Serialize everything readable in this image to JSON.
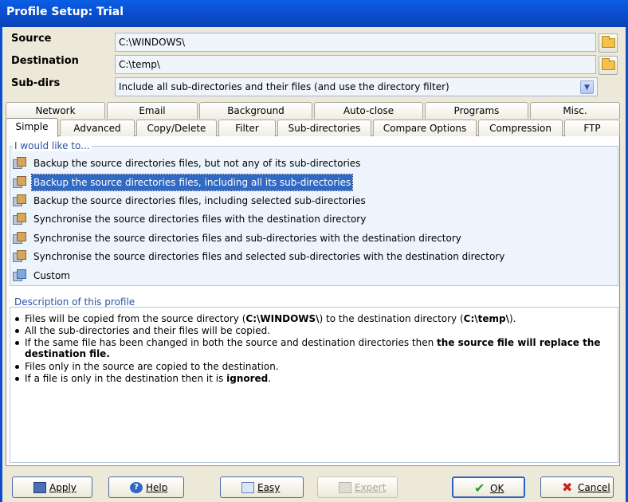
{
  "window": {
    "title": "Profile Setup: Trial"
  },
  "form": {
    "source_label": "Source",
    "source_value": "C:\\WINDOWS\\",
    "destination_label": "Destination",
    "destination_value": "C:\\temp\\",
    "subdirs_label": "Sub-dirs",
    "subdirs_value": "Include all sub-directories and their files (and use the directory filter)"
  },
  "tabs_row1": [
    "Network",
    "Email",
    "Background",
    "Auto-close",
    "Programs",
    "Misc."
  ],
  "tabs_row2": [
    "Simple",
    "Advanced",
    "Copy/Delete",
    "Filter",
    "Sub-directories",
    "Compare Options",
    "Compression",
    "FTP"
  ],
  "options_group": {
    "title": "I would like to...",
    "items": [
      "Backup the source directories files, but not any of its sub-directories",
      "Backup the source directories files, including all its sub-directories",
      "Backup the source directories files, including selected sub-directories",
      "Synchronise the source directories files with the destination directory",
      "Synchronise the source directories files and sub-directories with the destination directory",
      "Synchronise the source directories files and selected sub-directories with the destination directory",
      "Custom"
    ],
    "selected_index": 1
  },
  "description": {
    "title": "Description of this profile",
    "line1_a": "Files will be copied from the source directory (",
    "line1_b": "C:\\WINDOWS\\",
    "line1_c": ") to the destination directory (",
    "line1_d": "C:\\temp\\",
    "line1_e": ").",
    "line2": "All the sub-directories and their files will be copied.",
    "line3_a": "If the same file has been changed in both the source and destination directories then ",
    "line3_b": "the source file will replace the",
    "line3_c": "destination file.",
    "line4": "Files only in the source are copied to the destination.",
    "line5_a": "If a file is only in the destination then it is ",
    "line5_b": "ignored",
    "line5_c": "."
  },
  "buttons": {
    "apply": "Apply",
    "help": "Help",
    "easy": "Easy",
    "expert": "Expert",
    "ok": "OK",
    "cancel": "Cancel"
  }
}
